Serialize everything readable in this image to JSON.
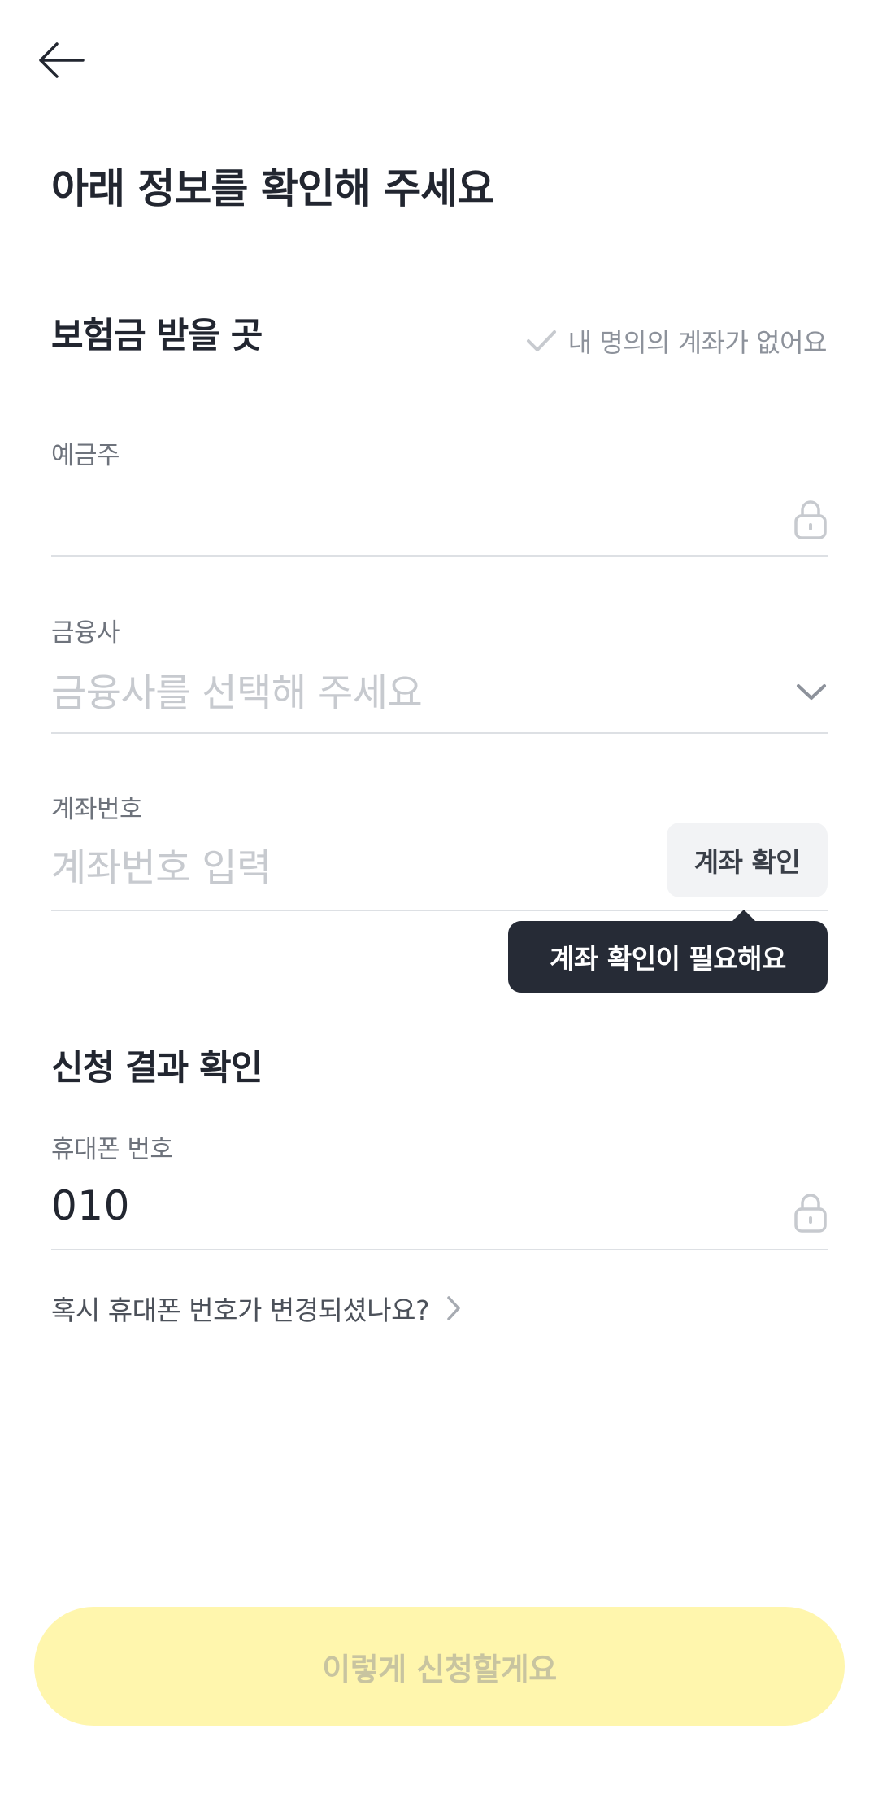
{
  "header": {
    "back_icon": "arrow-left-icon"
  },
  "page_title": "아래 정보를 확인해 주세요",
  "payout": {
    "section_title": "보험금 받을 곳",
    "no_account_label": "내 명의의 계좌가 없어요",
    "no_account_icon": "check-icon",
    "holder": {
      "label": "예금주",
      "value": "",
      "icon": "lock-icon"
    },
    "bank": {
      "label": "금융사",
      "placeholder": "금융사를 선택해 주세요",
      "icon": "chevron-down-icon"
    },
    "account": {
      "label": "계좌번호",
      "placeholder": "계좌번호 입력",
      "verify_button": "계좌 확인",
      "tooltip": "계좌 확인이 필요해요"
    }
  },
  "result": {
    "section_title": "신청 결과 확인",
    "phone": {
      "label": "휴대폰 번호",
      "value": "010",
      "icon": "lock-icon"
    },
    "change_link": "혹시 휴대폰 번호가 변경되셨나요?"
  },
  "submit_button": "이렇게 신청할게요",
  "colors": {
    "accent_disabled_bg": "#fff6ad",
    "tooltip_bg": "#262b36",
    "text_primary": "#222630",
    "placeholder": "#c7cacf"
  }
}
